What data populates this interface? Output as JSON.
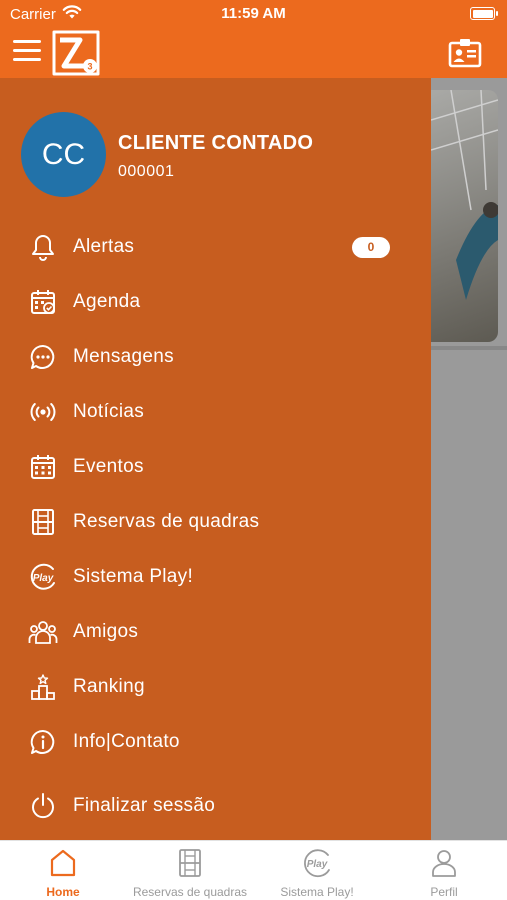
{
  "status_bar": {
    "carrier": "Carrier",
    "time": "11:59 AM"
  },
  "navbar": {
    "menu_icon": "hamburger-icon",
    "logo_icon": "app-logo-icon",
    "action_icon": "id-card-icon"
  },
  "drawer": {
    "user": {
      "initials": "CC",
      "name": "CLIENTE CONTADO",
      "code": "000001"
    },
    "items": [
      {
        "label": "Alertas",
        "icon": "bell-icon",
        "badge": "0"
      },
      {
        "label": "Agenda",
        "icon": "calendar-check-icon"
      },
      {
        "label": "Mensagens",
        "icon": "chat-bubble-icon"
      },
      {
        "label": "Notícias",
        "icon": "broadcast-icon"
      },
      {
        "label": "Eventos",
        "icon": "calendar-grid-icon"
      },
      {
        "label": "Reservas de quadras",
        "icon": "court-icon"
      },
      {
        "label": "Sistema Play!",
        "icon": "play-badge-icon"
      },
      {
        "label": "Amigos",
        "icon": "friends-icon"
      },
      {
        "label": "Ranking",
        "icon": "podium-icon"
      },
      {
        "label": "Info|Contato",
        "icon": "info-icon"
      },
      {
        "label": "Finalizar sessão",
        "icon": "power-icon"
      }
    ]
  },
  "tabbar": {
    "tabs": [
      {
        "label": "Home",
        "icon": "home-icon",
        "active": true
      },
      {
        "label": "Reservas de quadras",
        "icon": "court-icon",
        "active": false
      },
      {
        "label": "Sistema Play!",
        "icon": "play-badge-icon",
        "active": false
      },
      {
        "label": "Perfil",
        "icon": "person-icon",
        "active": false
      }
    ]
  },
  "colors": {
    "brand": "#ec6a1e",
    "drawer": "#c75d1f",
    "avatar": "#2272a9",
    "inactive_tab": "#9b9b9b"
  }
}
